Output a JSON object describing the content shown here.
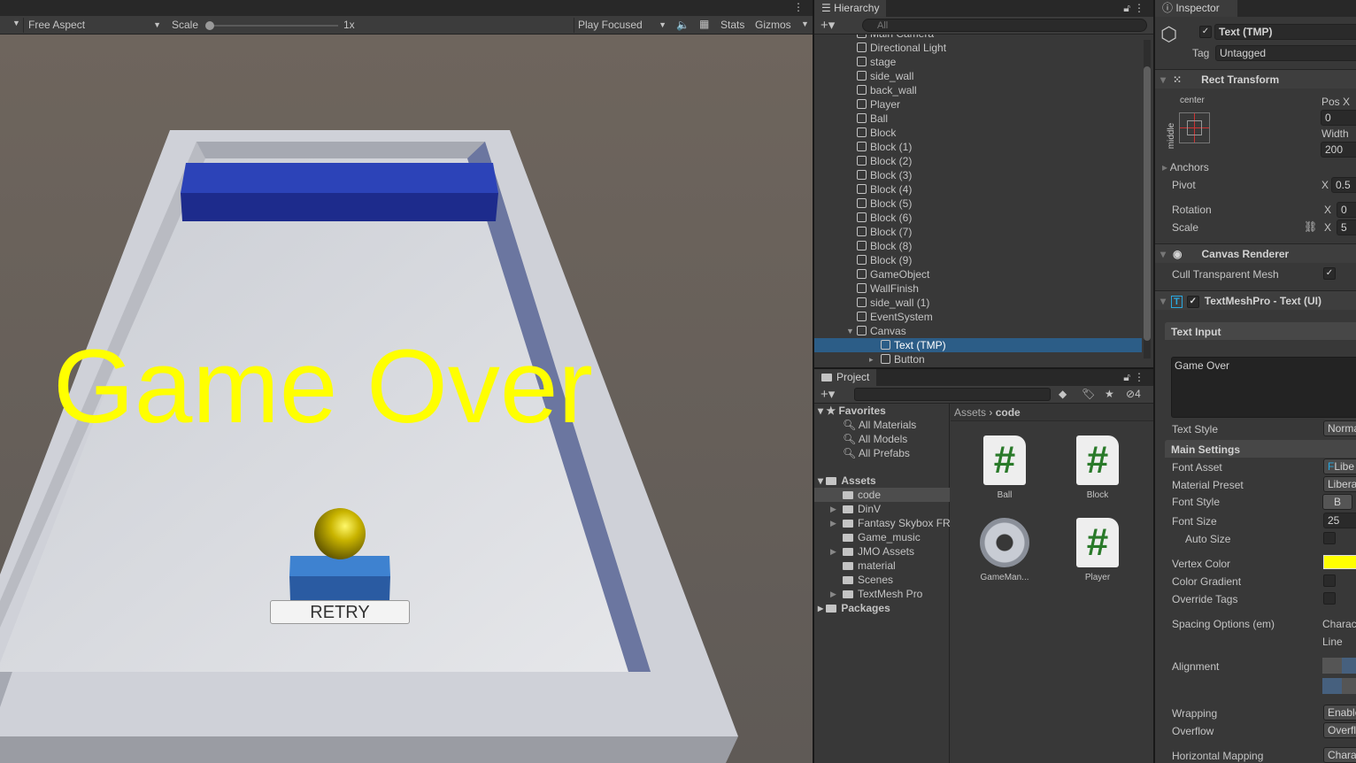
{
  "game": {
    "aspect": "Free Aspect",
    "scale_label": "Scale",
    "scale_value": "1x",
    "play_mode": "Play Focused",
    "stats": "Stats",
    "gizmos": "Gizmos",
    "overlay_text": "Game Over",
    "overlay_color": "#ffff00",
    "button_label": "RETRY"
  },
  "hierarchy": {
    "title": "Hierarchy",
    "search_placeholder": "All",
    "items": [
      "Main Camera",
      "Directional Light",
      "stage",
      "side_wall",
      "back_wall",
      "Player",
      "Ball",
      "Block",
      "Block (1)",
      "Block (2)",
      "Block (3)",
      "Block (4)",
      "Block (5)",
      "Block (6)",
      "Block (7)",
      "Block (8)",
      "Block (9)",
      "GameObject",
      "WallFinish",
      "side_wall (1)",
      "EventSystem",
      "Canvas"
    ],
    "children": [
      "Text (TMP)",
      "Button"
    ],
    "selected": "Text (TMP)"
  },
  "project": {
    "title": "Project",
    "hidden_count": "4",
    "favorites_label": "Favorites",
    "favorites": [
      "All Materials",
      "All Models",
      "All Prefabs"
    ],
    "assets_label": "Assets",
    "folders": [
      "code",
      "DinV",
      "Fantasy Skybox FR",
      "Game_music",
      "JMO Assets",
      "material",
      "Scenes",
      "TextMesh Pro"
    ],
    "packages_label": "Packages",
    "breadcrumb": [
      "Assets",
      "code"
    ],
    "files": [
      {
        "name": "Ball",
        "type": "script"
      },
      {
        "name": "Block",
        "type": "script"
      },
      {
        "name": "GameMan...",
        "type": "gear"
      },
      {
        "name": "Player",
        "type": "script"
      }
    ]
  },
  "inspector": {
    "title": "Inspector",
    "object_name": "Text (TMP)",
    "tag_label": "Tag",
    "tag_value": "Untagged",
    "rect_transform": {
      "title": "Rect Transform",
      "anchor_h": "center",
      "anchor_v": "middle",
      "pos_x_label": "Pos X",
      "pos_x": "0",
      "width_label": "Width",
      "width": "200",
      "anchors": "Anchors",
      "pivot": "Pivot",
      "pivot_x": "0.5",
      "rotation": "Rotation",
      "rotation_x": "0",
      "scale": "Scale",
      "scale_x": "5",
      "x": "X"
    },
    "canvas_renderer": {
      "title": "Canvas Renderer",
      "cull": "Cull Transparent Mesh"
    },
    "tmp": {
      "title": "TextMeshPro - Text (UI)",
      "text_input": "Text Input",
      "text": "Game Over",
      "text_style": "Text Style",
      "text_style_value": "Norma",
      "main_settings": "Main Settings",
      "font_asset": "Font Asset",
      "font_asset_value": "Libe",
      "material_preset": "Material Preset",
      "material_preset_value": "Libera",
      "font_style": "Font Style",
      "bold": "B",
      "font_size": "Font Size",
      "font_size_value": "25",
      "auto_size": "Auto Size",
      "vertex_color": "Vertex Color",
      "vertex_color_value": "#ffff00",
      "color_gradient": "Color Gradient",
      "override_tags": "Override Tags",
      "spacing": "Spacing Options (em)",
      "spacing_char": "Charac",
      "spacing_line": "Line",
      "alignment": "Alignment",
      "wrapping": "Wrapping",
      "wrapping_value": "Enable",
      "overflow": "Overflow",
      "overflow_value": "Overfl",
      "hmapping": "Horizontal Mapping",
      "hmapping_value": "Chara"
    }
  }
}
